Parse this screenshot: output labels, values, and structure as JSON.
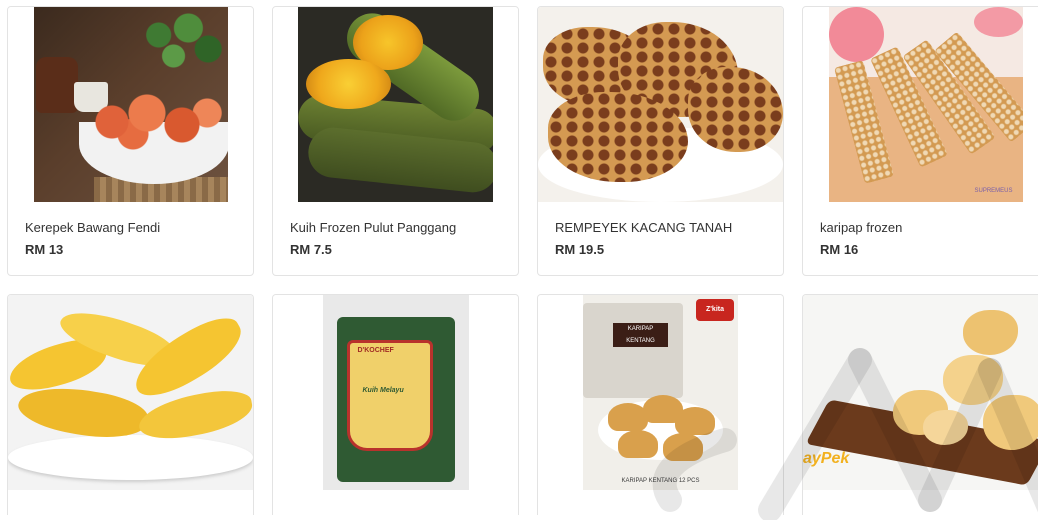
{
  "products": [
    {
      "name": "Kerepek Bawang Fendi",
      "price": "RM 13"
    },
    {
      "name": "Kuih Frozen Pulut Panggang",
      "price": "RM 7.5"
    },
    {
      "name": "REMPEYEK KACANG TANAH",
      "price": "RM 19.5"
    },
    {
      "name": "karipap frozen",
      "price": "RM 16"
    },
    {
      "name": "",
      "price": ""
    },
    {
      "name": "",
      "price": ""
    },
    {
      "name": "",
      "price": ""
    },
    {
      "name": "",
      "price": ""
    }
  ],
  "image_text": {
    "p6_brand": "D'KOCHEF",
    "p6_variety": "Kuih Melayu",
    "p7_badge": "Z'kita",
    "p7_tag": "KARIPAP KENTANG",
    "p7_caption": "KARIPAP KENTANG 12 PCS",
    "p8_brand": "ayPek",
    "p4_logo": "SUPREMEUS"
  },
  "colors": {
    "card_border": "#e3e3e3",
    "text": "#333333",
    "watermark": "#000000"
  }
}
